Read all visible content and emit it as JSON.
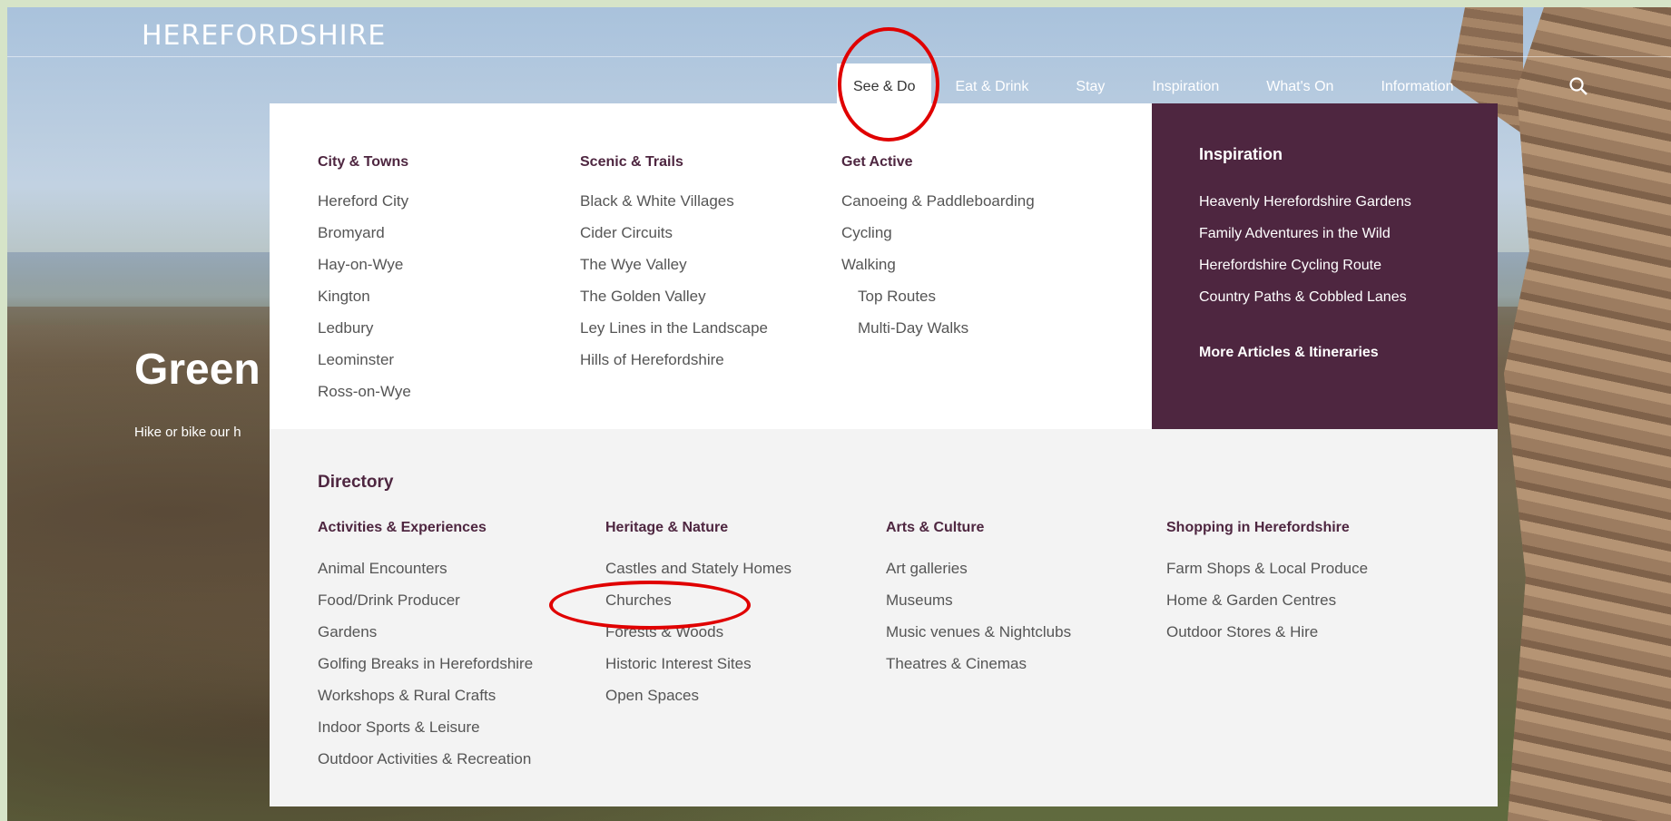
{
  "logo": "HEREFORDSHIRE",
  "nav": [
    {
      "label": "See & Do",
      "active": true
    },
    {
      "label": "Eat & Drink"
    },
    {
      "label": "Stay"
    },
    {
      "label": "Inspiration"
    },
    {
      "label": "What's On"
    },
    {
      "label": "Information"
    }
  ],
  "hero": {
    "title": "Green",
    "subtitle": "Hike or bike our h"
  },
  "menu": {
    "columns": [
      {
        "head": "City & Towns",
        "items": [
          "Hereford City",
          "Bromyard",
          "Hay-on-Wye",
          "Kington",
          "Ledbury",
          "Leominster",
          "Ross-on-Wye"
        ]
      },
      {
        "head": "Scenic & Trails",
        "items": [
          "Black & White Villages",
          "Cider Circuits",
          "The Wye Valley",
          "The Golden Valley",
          "Ley Lines in the Landscape",
          "Hills of Herefordshire"
        ]
      },
      {
        "head": "Get Active",
        "items": [
          "Canoeing & Paddleboarding",
          "Cycling",
          "Walking",
          "Top Routes",
          "Multi-Day Walks"
        ]
      }
    ],
    "inspiration": {
      "head": "Inspiration",
      "items": [
        "Heavenly Herefordshire Gardens",
        "Family Adventures in the Wild",
        "Herefordshire Cycling Route",
        "Country Paths & Cobbled Lanes"
      ],
      "more": "More Articles & Itineraries"
    },
    "directory": {
      "head": "Directory",
      "columns": [
        {
          "head": "Activities & Experiences",
          "items": [
            "Animal Encounters",
            "Food/Drink Producer",
            "Gardens",
            "Golfing Breaks in Herefordshire",
            "Workshops & Rural Crafts",
            "Indoor Sports & Leisure",
            "Outdoor Activities & Recreation"
          ]
        },
        {
          "head": "Heritage & Nature",
          "items": [
            "Castles and Stately Homes",
            "Churches",
            "Forests & Woods",
            "Historic Interest Sites",
            "Open Spaces"
          ]
        },
        {
          "head": "Arts & Culture",
          "items": [
            "Art galleries",
            "Museums",
            "Music venues & Nightclubs",
            "Theatres & Cinemas"
          ]
        },
        {
          "head": "Shopping in Herefordshire",
          "items": [
            "Farm Shops & Local Produce",
            "Home & Garden Centres",
            "Outdoor Stores & Hire"
          ]
        }
      ]
    }
  },
  "colors": {
    "accent": "#4e2640",
    "annotation": "#e00000"
  },
  "icons": {
    "search": "search-icon"
  }
}
